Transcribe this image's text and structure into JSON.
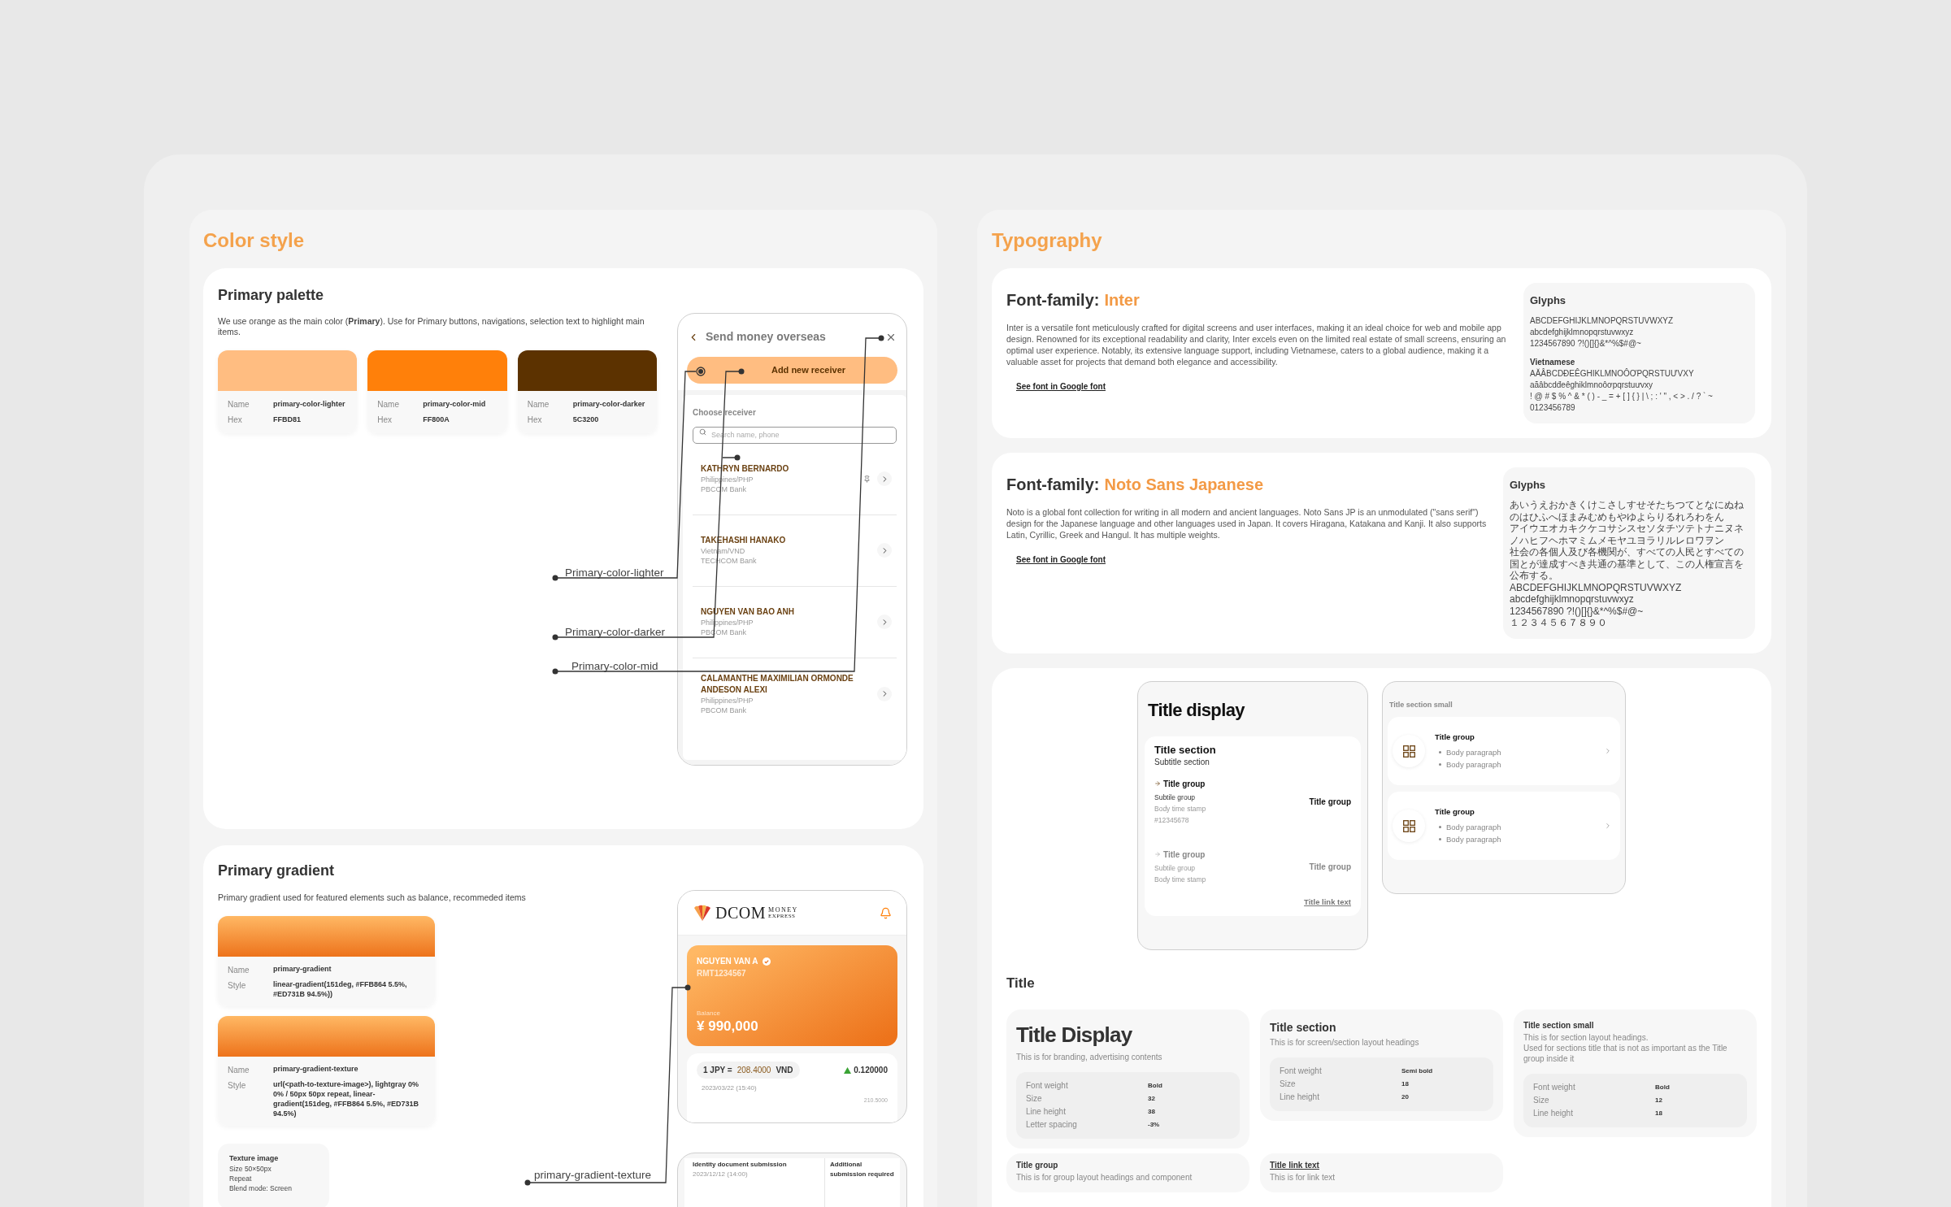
{
  "color_style": {
    "title": "Color style",
    "palette": {
      "title": "Primary palette",
      "description": "We use orange as the main color (**Primary**). Use for Primary buttons, navigations, selection text to highlight main items.",
      "swatches": [
        {
          "color": "#ffbd81",
          "name_label": "Name",
          "name": "primary-color-lighter",
          "hex_label": "Hex",
          "hex": "FFBD81"
        },
        {
          "color": "#ff800a",
          "name_label": "Name",
          "name": "primary-color-mid",
          "hex_label": "Hex",
          "hex": "FF800A"
        },
        {
          "color": "#5c3200",
          "name_label": "Name",
          "name": "primary-color-darker",
          "hex_label": "Hex",
          "hex": "5C3200"
        }
      ],
      "annotations": [
        "Primary-color-lighter",
        "Primary-color-darker",
        "Primary-color-mid"
      ],
      "phone": {
        "title": "Send money overseas",
        "button": "Add new receiver",
        "list_label": "Choose receiver",
        "search_placeholder": "Search name, phone",
        "receivers": [
          {
            "name": "KATHRYN BERNARDO",
            "country": "Philippines/PHP",
            "bank": "PBCOM Bank",
            "pinned": true
          },
          {
            "name": "TAKEHASHI HANAKO",
            "country": "Vietnam/VND",
            "bank": "TECHCOM Bank",
            "pinned": false
          },
          {
            "name": "NGUYEN VAN BAO ANH",
            "country": "Philippines/PHP",
            "bank": "PBCOM Bank",
            "pinned": false
          },
          {
            "name": "CALAMANTHE MAXIMILIAN ORMONDE ANDESON ALEXI",
            "country": "Philippines/PHP",
            "bank": "PBCOM Bank",
            "pinned": false
          }
        ]
      }
    },
    "gradient": {
      "title": "Primary gradient",
      "description": "Primary gradient used for featured elements such as balance, recommeded items",
      "swatches": [
        {
          "name_label": "Name",
          "name": "primary-gradient",
          "style_label": "Style",
          "style": "linear-gradient(151deg, #FFB864 5.5%, #ED731B 94.5%))"
        },
        {
          "name_label": "Name",
          "name": "primary-gradient-texture",
          "style_label": "Style",
          "style": "url(<path-to-texture-image>), lightgray 0% 0% / 50px 50px repeat, linear-gradient(151deg, #FFB864 5.5%, #ED731B 94.5%)"
        }
      ],
      "texture": {
        "title": "Texture image",
        "lines": [
          "Size 50×50px",
          "Repeat",
          "Blend mode: Screen"
        ]
      },
      "annotation": "primary-gradient-texture",
      "phone": {
        "logo": "DCOM",
        "logo_top": "MONEY",
        "logo_bottom": "EXPRESS",
        "account_name": "NGUYEN VAN A",
        "account_id": "RMT1234567",
        "balance_label": "Balance",
        "balance": "¥ 990,000",
        "rate_left": "1 JPY =",
        "rate_value": "208.4000",
        "rate_right": "VND",
        "change": "0.120000",
        "rate_time": "2023/03/22  (15:40)",
        "chart_label": "210.5000"
      },
      "phone2": {
        "title": "Identity document submission",
        "date": "2023/12/12 (14:00)",
        "status": "Additional submission required"
      }
    }
  },
  "typography": {
    "title": "Typography",
    "fonts": [
      {
        "label": "Font-family:",
        "family": "Inter",
        "description": "Inter is a versatile font meticulously crafted for digital screens and user interfaces, making it an ideal choice for web and mobile app design. Renowned for its exceptional readability and clarity, Inter excels even on the limited real estate of small screens, ensuring an optimal user experience. Notably, its extensive language support, including Vietnamese, caters to a global audience, making it a valuable asset for projects that demand both elegance and accessibility.",
        "link": "See font in Google font",
        "glyphs_title": "Glyphs",
        "glyph_lines": [
          "ABCDEFGHIJKLMNOPQRSTUVWXYZ",
          "abcdefghijklmnopqrstuvwxyz",
          "1234567890 ?!()[]{}&*^%$#@~"
        ],
        "extra_title": "Vietnamese",
        "extra_lines": [
          "AĂÂBCDĐEÊGHIKLMNOÔƠPQRSTUƯVXY",
          "aăâbcdđeêghiklmnoôơpqrstuưvxy",
          "! @ # $ % ^ & * ( ) - _ = + [ ] { } | \\ ; : ' \" , < > . / ? ` ~",
          "0123456789"
        ]
      },
      {
        "label": "Font-family:",
        "family": "Noto Sans Japanese",
        "description": "Noto is a global font collection for writing in all modern and ancient languages. Noto Sans JP is an unmodulated (\"sans serif\") design for the Japanese language and other languages used in Japan. It covers Hiragana, Katakana and Kanji. It also supports Latin, Cyrillic, Greek and Hangul. It has multiple weights.",
        "link": "See font in Google font",
        "glyphs_title": "Glyphs",
        "glyph_lines": [
          "あいうえおかきくけこさしすせそたちつてとなにぬね",
          "のはひふへほまみむめもやゆよらりるれろわをん",
          "アイウエオカキクケコサシスセソタチツテトナニヌネ",
          "ノハヒフヘホマミムメモヤユヨラリルレロワヲン",
          "社会の各個人及び各機関が、すべての人民とすべての国とが達成すべき共通の基準として、この人権宣言を公布する。",
          "ABCDEFGHIJKLMNOPQRSTUVWXYZ",
          "abcdefghijklmnopqrstuvwxyz",
          "1234567890 ?!()[]{}&*^%$#@~",
          "１２３４５６７８９０"
        ]
      }
    ],
    "display_frame": {
      "title": "Title display",
      "section_title": "Title section",
      "section_subtitle": "Subtitle section",
      "groups": [
        {
          "title": "Title group",
          "subtitle": "Subtile group",
          "timestamp": "Body time stamp",
          "code": "#12345678",
          "value": "Title group",
          "muted": false
        },
        {
          "title": "Title group",
          "subtitle": "Subtile group",
          "timestamp": "Body time stamp",
          "value": "Title group",
          "muted": true
        }
      ],
      "link": "Title link text"
    },
    "small_frame": {
      "label": "Title section small",
      "items": [
        {
          "title": "Title group",
          "bullets": [
            "Body paragraph",
            "Body paragraph"
          ]
        },
        {
          "title": "Title group",
          "bullets": [
            "Body paragraph",
            "Body paragraph"
          ]
        }
      ]
    },
    "title_heading": "Title",
    "title_styles": [
      {
        "kind": "display",
        "name": "Title Display",
        "description": "This is for branding, advertising contents",
        "specs": [
          {
            "label": "Font weight",
            "value": "Bold"
          },
          {
            "label": "Size",
            "value": "32"
          },
          {
            "label": "Line height",
            "value": "38"
          },
          {
            "label": "Letter spacing",
            "value": "-3%"
          }
        ]
      },
      {
        "kind": "section",
        "name": "Title section",
        "description": "This is for screen/section layout headings",
        "specs": [
          {
            "label": "Font weight",
            "value": "Semi bold"
          },
          {
            "label": "Size",
            "value": "18"
          },
          {
            "label": "Line height",
            "value": "20"
          }
        ]
      },
      {
        "kind": "section_small",
        "name": "Title section small",
        "description": "This is for section layout headings.\nUsed for sections title that is not as important as the Title group inside it",
        "specs": [
          {
            "label": "Font weight",
            "value": "Bold"
          },
          {
            "label": "Size",
            "value": "12"
          },
          {
            "label": "Line height",
            "value": "18"
          }
        ]
      },
      {
        "kind": "group",
        "name": "Title group",
        "description": "This is for group layout headings and component"
      },
      {
        "kind": "link",
        "name": "Title link text",
        "description": "This is for link text"
      }
    ]
  }
}
